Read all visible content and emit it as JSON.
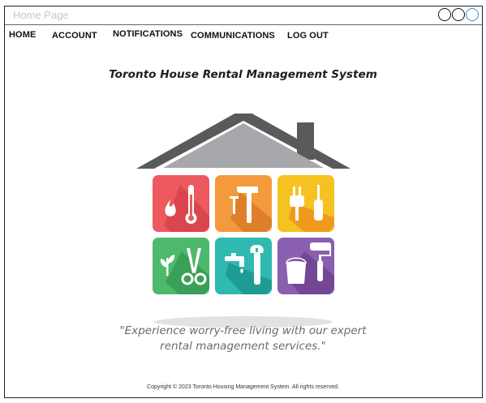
{
  "window": {
    "title": "Home Page"
  },
  "nav": {
    "items": [
      {
        "label": "HOME"
      },
      {
        "label": "ACCOUNT"
      },
      {
        "label": "NOTIFICATIONS"
      },
      {
        "label": "COMMUNICATIONS"
      },
      {
        "label": "LOG OUT"
      }
    ]
  },
  "main": {
    "heading": "Toronto House Rental Management System",
    "tagline_line1": "\"Experience worry-free living with our expert",
    "tagline_line2": "rental management services.\""
  },
  "footer": {
    "copyright": "Copyright © 2023 Toronto Housing Management System. All rights reserved."
  },
  "logo": {
    "tile_colors": [
      "#ec5a5f",
      "#f39a3c",
      "#f5c221",
      "#4cb96b",
      "#2fb9b0",
      "#8a5fb0"
    ],
    "tile_icons": [
      "flame-thermometer-icon",
      "hammer-nail-icon",
      "plug-screwdriver-icon",
      "plant-scissors-icon",
      "faucet-wrench-icon",
      "paint-roller-bucket-icon"
    ],
    "roof_color": "#5a5a5a"
  }
}
